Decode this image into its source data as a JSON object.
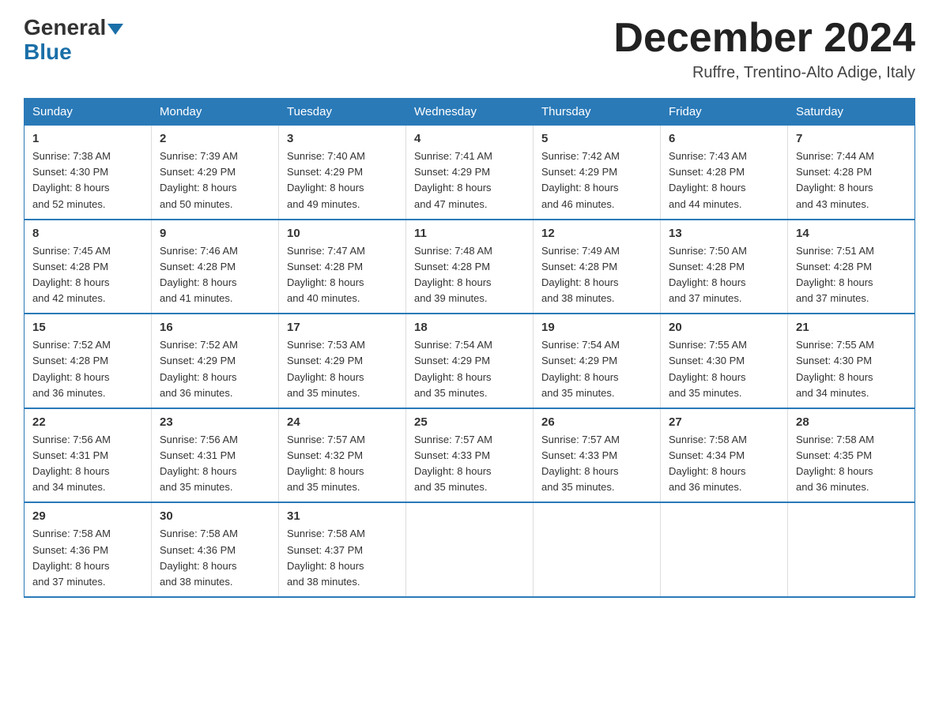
{
  "logo": {
    "general": "General",
    "blue": "Blue"
  },
  "title": "December 2024",
  "subtitle": "Ruffre, Trentino-Alto Adige, Italy",
  "days_header": [
    "Sunday",
    "Monday",
    "Tuesday",
    "Wednesday",
    "Thursday",
    "Friday",
    "Saturday"
  ],
  "weeks": [
    [
      {
        "day": "1",
        "sunrise": "7:38 AM",
        "sunset": "4:30 PM",
        "daylight": "8 hours and 52 minutes."
      },
      {
        "day": "2",
        "sunrise": "7:39 AM",
        "sunset": "4:29 PM",
        "daylight": "8 hours and 50 minutes."
      },
      {
        "day": "3",
        "sunrise": "7:40 AM",
        "sunset": "4:29 PM",
        "daylight": "8 hours and 49 minutes."
      },
      {
        "day": "4",
        "sunrise": "7:41 AM",
        "sunset": "4:29 PM",
        "daylight": "8 hours and 47 minutes."
      },
      {
        "day": "5",
        "sunrise": "7:42 AM",
        "sunset": "4:29 PM",
        "daylight": "8 hours and 46 minutes."
      },
      {
        "day": "6",
        "sunrise": "7:43 AM",
        "sunset": "4:28 PM",
        "daylight": "8 hours and 44 minutes."
      },
      {
        "day": "7",
        "sunrise": "7:44 AM",
        "sunset": "4:28 PM",
        "daylight": "8 hours and 43 minutes."
      }
    ],
    [
      {
        "day": "8",
        "sunrise": "7:45 AM",
        "sunset": "4:28 PM",
        "daylight": "8 hours and 42 minutes."
      },
      {
        "day": "9",
        "sunrise": "7:46 AM",
        "sunset": "4:28 PM",
        "daylight": "8 hours and 41 minutes."
      },
      {
        "day": "10",
        "sunrise": "7:47 AM",
        "sunset": "4:28 PM",
        "daylight": "8 hours and 40 minutes."
      },
      {
        "day": "11",
        "sunrise": "7:48 AM",
        "sunset": "4:28 PM",
        "daylight": "8 hours and 39 minutes."
      },
      {
        "day": "12",
        "sunrise": "7:49 AM",
        "sunset": "4:28 PM",
        "daylight": "8 hours and 38 minutes."
      },
      {
        "day": "13",
        "sunrise": "7:50 AM",
        "sunset": "4:28 PM",
        "daylight": "8 hours and 37 minutes."
      },
      {
        "day": "14",
        "sunrise": "7:51 AM",
        "sunset": "4:28 PM",
        "daylight": "8 hours and 37 minutes."
      }
    ],
    [
      {
        "day": "15",
        "sunrise": "7:52 AM",
        "sunset": "4:28 PM",
        "daylight": "8 hours and 36 minutes."
      },
      {
        "day": "16",
        "sunrise": "7:52 AM",
        "sunset": "4:29 PM",
        "daylight": "8 hours and 36 minutes."
      },
      {
        "day": "17",
        "sunrise": "7:53 AM",
        "sunset": "4:29 PM",
        "daylight": "8 hours and 35 minutes."
      },
      {
        "day": "18",
        "sunrise": "7:54 AM",
        "sunset": "4:29 PM",
        "daylight": "8 hours and 35 minutes."
      },
      {
        "day": "19",
        "sunrise": "7:54 AM",
        "sunset": "4:29 PM",
        "daylight": "8 hours and 35 minutes."
      },
      {
        "day": "20",
        "sunrise": "7:55 AM",
        "sunset": "4:30 PM",
        "daylight": "8 hours and 35 minutes."
      },
      {
        "day": "21",
        "sunrise": "7:55 AM",
        "sunset": "4:30 PM",
        "daylight": "8 hours and 34 minutes."
      }
    ],
    [
      {
        "day": "22",
        "sunrise": "7:56 AM",
        "sunset": "4:31 PM",
        "daylight": "8 hours and 34 minutes."
      },
      {
        "day": "23",
        "sunrise": "7:56 AM",
        "sunset": "4:31 PM",
        "daylight": "8 hours and 35 minutes."
      },
      {
        "day": "24",
        "sunrise": "7:57 AM",
        "sunset": "4:32 PM",
        "daylight": "8 hours and 35 minutes."
      },
      {
        "day": "25",
        "sunrise": "7:57 AM",
        "sunset": "4:33 PM",
        "daylight": "8 hours and 35 minutes."
      },
      {
        "day": "26",
        "sunrise": "7:57 AM",
        "sunset": "4:33 PM",
        "daylight": "8 hours and 35 minutes."
      },
      {
        "day": "27",
        "sunrise": "7:58 AM",
        "sunset": "4:34 PM",
        "daylight": "8 hours and 36 minutes."
      },
      {
        "day": "28",
        "sunrise": "7:58 AM",
        "sunset": "4:35 PM",
        "daylight": "8 hours and 36 minutes."
      }
    ],
    [
      {
        "day": "29",
        "sunrise": "7:58 AM",
        "sunset": "4:36 PM",
        "daylight": "8 hours and 37 minutes."
      },
      {
        "day": "30",
        "sunrise": "7:58 AM",
        "sunset": "4:36 PM",
        "daylight": "8 hours and 38 minutes."
      },
      {
        "day": "31",
        "sunrise": "7:58 AM",
        "sunset": "4:37 PM",
        "daylight": "8 hours and 38 minutes."
      },
      null,
      null,
      null,
      null
    ]
  ],
  "labels": {
    "sunrise": "Sunrise:",
    "sunset": "Sunset:",
    "daylight": "Daylight:"
  }
}
